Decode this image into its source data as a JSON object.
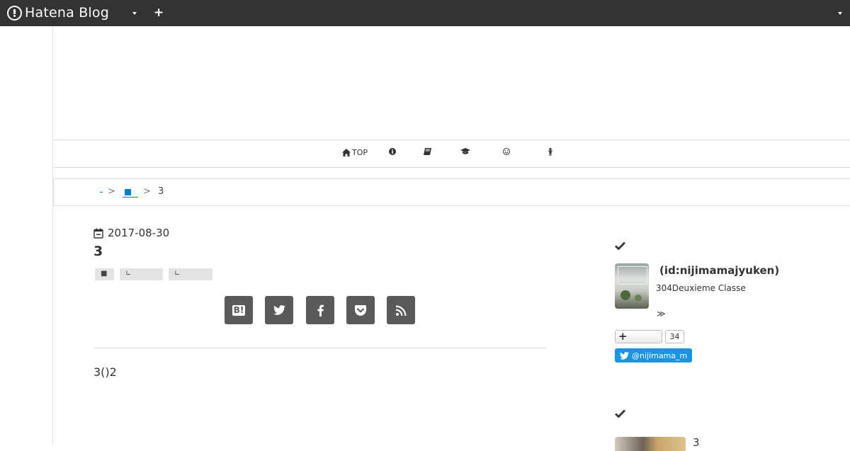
{
  "header": {
    "brand": "Hatena Blog"
  },
  "nav": {
    "items": [
      {
        "label": "TOP",
        "icon": "home-icon"
      },
      {
        "label": "",
        "icon": "info-circle-icon"
      },
      {
        "label": "",
        "icon": "book-icon"
      },
      {
        "label": "",
        "icon": "graduation-cap-icon"
      },
      {
        "label": "",
        "icon": "smile-icon"
      },
      {
        "label": "",
        "icon": "child-icon"
      }
    ]
  },
  "breadcrumb": {
    "separator": ">",
    "current": "3"
  },
  "article": {
    "date": "2017-08-30",
    "title": "3",
    "categories": [
      "■",
      "∟",
      "∟"
    ],
    "body": "3()2"
  },
  "share": {
    "items": [
      "hatena-bookmark-icon",
      "twitter-icon",
      "facebook-icon",
      "pocket-icon",
      "rss-icon"
    ],
    "hatena_label": "B!"
  },
  "profile": {
    "id": "(id:nijimamajyuken)",
    "description": "304Deuxieme Classe",
    "more": "≫",
    "subscribe_count": "34",
    "twitter_label": "@nijimama_m"
  },
  "recent": {
    "first_title": "3"
  },
  "colors": {
    "topbar": "#333333",
    "link": "#0a7fbf",
    "share_button": "#5a5a5a",
    "twitter": "#1b95e0"
  }
}
